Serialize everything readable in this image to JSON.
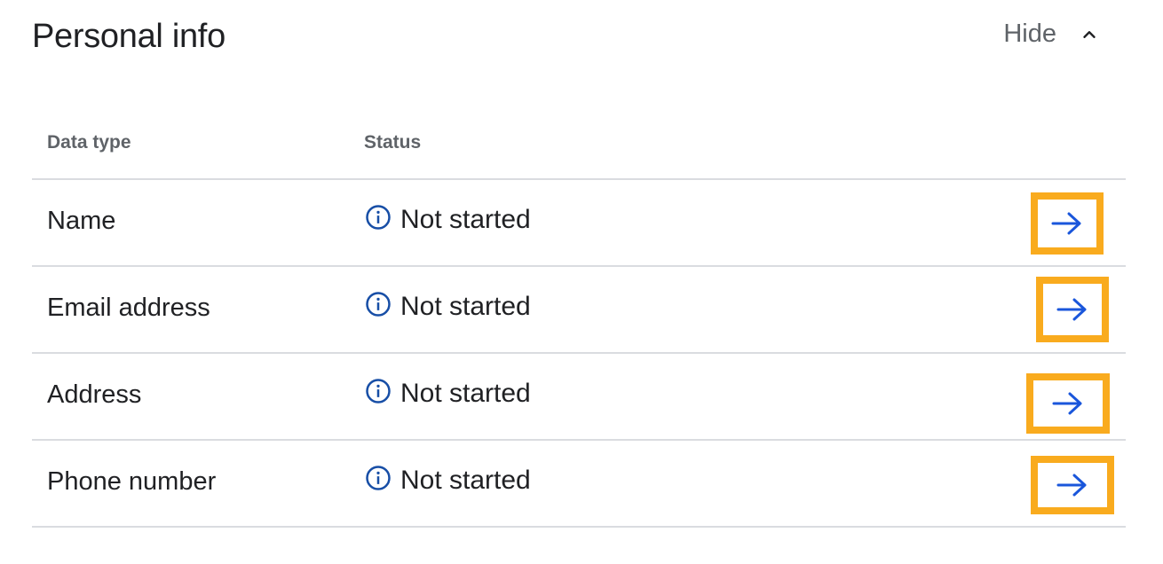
{
  "section": {
    "title": "Personal info",
    "toggle_label": "Hide",
    "toggle_icon": "chevron-up-icon"
  },
  "table": {
    "headers": {
      "data_type": "Data type",
      "status": "Status"
    },
    "rows": [
      {
        "data_type": "Name",
        "status": "Not started",
        "status_icon": "info-icon",
        "action_icon": "arrow-right-icon"
      },
      {
        "data_type": "Email address",
        "status": "Not started",
        "status_icon": "info-icon",
        "action_icon": "arrow-right-icon"
      },
      {
        "data_type": "Address",
        "status": "Not started",
        "status_icon": "info-icon",
        "action_icon": "arrow-right-icon"
      },
      {
        "data_type": "Phone number",
        "status": "Not started",
        "status_icon": "info-icon",
        "action_icon": "arrow-right-icon"
      }
    ]
  },
  "colors": {
    "highlight_border": "#f9ab1e",
    "arrow": "#1a56db",
    "info_icon": "#174ea6",
    "divider": "#dadce0"
  }
}
